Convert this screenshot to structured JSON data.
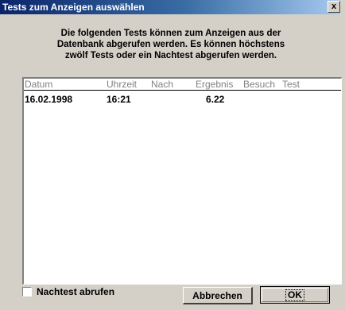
{
  "window": {
    "title": "Tests zum Anzeigen auswählen",
    "close_label": "x"
  },
  "instructions": [
    "Die folgenden Tests können zum Anzeigen aus der",
    "Datenbank abgerufen werden. Es können höchstens",
    "zwölf Tests oder ein Nachtest abgerufen werden."
  ],
  "table": {
    "columns": [
      "Datum",
      "Uhrzeit",
      "Nach",
      "Ergebnis",
      "Besuch",
      "Test"
    ],
    "rows": [
      {
        "datum": "16.02.1998",
        "uhrzeit": "16:21",
        "nach": "",
        "ergebnis": "6.22",
        "besuch": "",
        "test": ""
      }
    ]
  },
  "options": {
    "nachtest_label": "Nachtest abrufen",
    "nachtest_checked": false
  },
  "buttons": {
    "cancel_label": "Abbrechen",
    "ok_label": "OK"
  }
}
